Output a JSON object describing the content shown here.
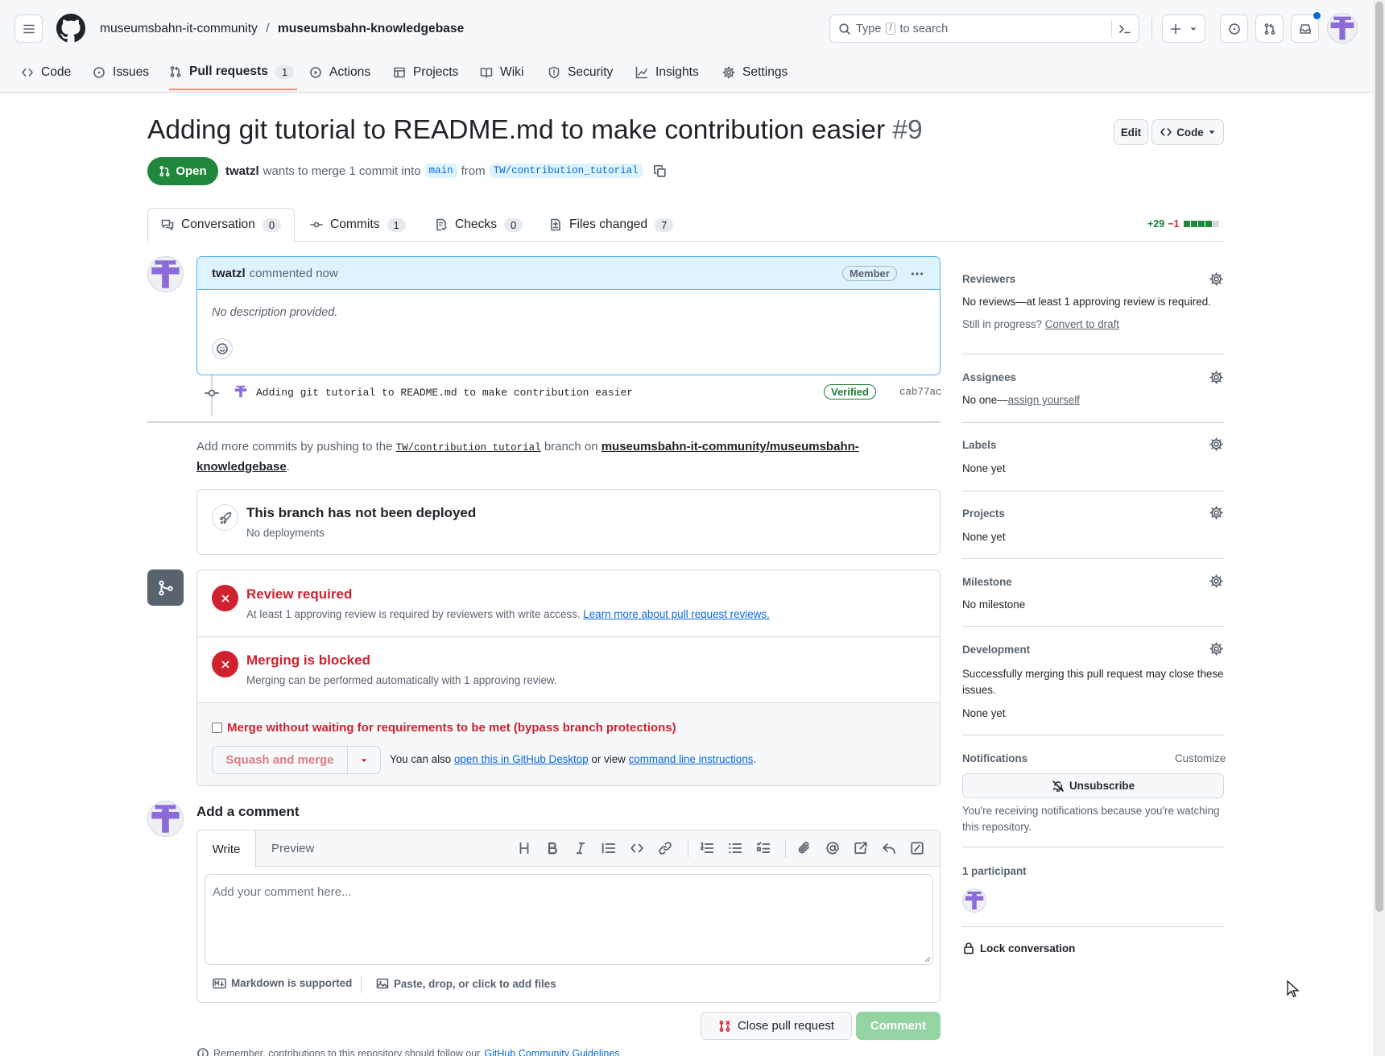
{
  "header": {
    "org": "museumsbahn-it-community",
    "separator": "/",
    "repo": "museumsbahn-knowledgebase",
    "search_before": "Type",
    "search_key": "/",
    "search_after": "to search"
  },
  "repo_tabs": [
    {
      "label": "Code",
      "icon": "code-icon"
    },
    {
      "label": "Issues",
      "icon": "issue-icon"
    },
    {
      "label": "Pull requests",
      "icon": "pull-request-icon",
      "count": "1"
    },
    {
      "label": "Actions",
      "icon": "play-icon"
    },
    {
      "label": "Projects",
      "icon": "table-icon"
    },
    {
      "label": "Wiki",
      "icon": "book-icon"
    },
    {
      "label": "Security",
      "icon": "shield-icon"
    },
    {
      "label": "Insights",
      "icon": "graph-icon"
    },
    {
      "label": "Settings",
      "icon": "gear-icon"
    }
  ],
  "pr": {
    "title": "Adding git tutorial to README.md to make contribution easier",
    "number": "#9",
    "edit_label": "Edit",
    "code_label": "Code",
    "state": "Open",
    "author": "twatzl",
    "merge_text": "wants to merge 1 commit into",
    "base_branch": "main",
    "from_text": "from",
    "head_branch": "TW/contribution_tutorial"
  },
  "pr_tabs": [
    {
      "label": "Conversation",
      "count": "0",
      "icon": "comment-icon"
    },
    {
      "label": "Commits",
      "count": "1",
      "icon": "commit-icon"
    },
    {
      "label": "Checks",
      "count": "0",
      "icon": "checklist-icon"
    },
    {
      "label": "Files changed",
      "count": "7",
      "icon": "file-diff-icon"
    }
  ],
  "diffstat": {
    "added": "+29",
    "removed": "−1"
  },
  "comment": {
    "author": "twatzl",
    "meta": "commented now",
    "badge": "Member",
    "body": "No description provided."
  },
  "commit": {
    "message": "Adding git tutorial to README.md to make contribution easier",
    "verified": "Verified",
    "sha": "cab77ac"
  },
  "push_info": {
    "prefix": "Add more commits by pushing to the",
    "branch": "TW/contribution_tutorial",
    "middle": "branch on",
    "repo_link": "museumsbahn-it-community/museumsbahn-knowledgebase",
    "suffix": "."
  },
  "deploy": {
    "title": "This branch has not been deployed",
    "subtitle": "No deployments"
  },
  "merge": {
    "review_title": "Review required",
    "review_text": "At least 1 approving review is required by reviewers with write access.",
    "review_link": "Learn more about pull request reviews.",
    "blocked_title": "Merging is blocked",
    "blocked_text": "Merging can be performed automatically with 1 approving review.",
    "bypass_label": "Merge without waiting for requirements to be met (bypass branch protections)",
    "squash_label": "Squash and merge",
    "also_text": "You can also",
    "desktop_link": "open this in GitHub Desktop",
    "or_text": "or view",
    "cli_link": "command line instructions",
    "period": "."
  },
  "add_comment": {
    "heading": "Add a comment",
    "write_tab": "Write",
    "preview_tab": "Preview",
    "placeholder": "Add your comment here...",
    "markdown_note": "Markdown is supported",
    "files_note": "Paste, drop, or click to add files",
    "close_label": "Close pull request",
    "comment_label": "Comment",
    "remember_prefix": "Remember, contributions to this repository should follow our",
    "guidelines_link": "GitHub Community Guidelines"
  },
  "sidebar": {
    "reviewers_label": "Reviewers",
    "reviewers_text": "No reviews—at least 1 approving review is required.",
    "in_progress": "Still in progress?",
    "convert_link": "Convert to draft",
    "assignees_label": "Assignees",
    "assignees_text": "No one—",
    "assign_link": "assign yourself",
    "labels_label": "Labels",
    "labels_text": "None yet",
    "projects_label": "Projects",
    "projects_text": "None yet",
    "milestone_label": "Milestone",
    "milestone_text": "No milestone",
    "development_label": "Development",
    "development_text": "Successfully merging this pull request may close these issues.",
    "development_none": "None yet",
    "notifications_label": "Notifications",
    "customize_link": "Customize",
    "unsubscribe_label": "Unsubscribe",
    "notify_text": "You're receiving notifications because you're watching this repository.",
    "participants_label": "1 participant",
    "lock_label": "Lock conversation"
  },
  "colors": {
    "accent": "#0969da",
    "open": "#1f883d",
    "danger": "#cf222e",
    "tab_underline": "#fd8c73",
    "identicon": "#8c6bd8"
  }
}
